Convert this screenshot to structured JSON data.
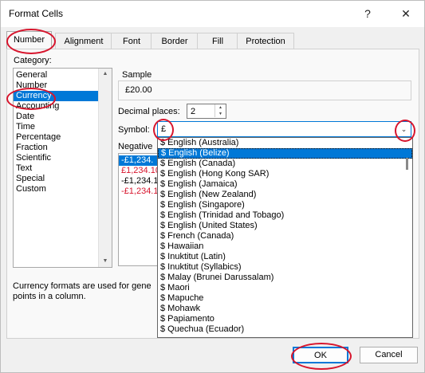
{
  "window": {
    "title": "Format Cells",
    "help_glyph": "?",
    "close_glyph": "✕"
  },
  "tabs": [
    "Number",
    "Alignment",
    "Font",
    "Border",
    "Fill",
    "Protection"
  ],
  "category": {
    "label": "Category:",
    "items": [
      "General",
      "Number",
      "Currency",
      "Accounting",
      "Date",
      "Time",
      "Percentage",
      "Fraction",
      "Scientific",
      "Text",
      "Special",
      "Custom"
    ],
    "selected": "Currency"
  },
  "sample": {
    "label": "Sample",
    "value": "£20.00"
  },
  "decimal": {
    "label": "Decimal places:",
    "value": "2"
  },
  "symbol": {
    "label": "Symbol:",
    "value": "£",
    "options": [
      "$ English (Australia)",
      "$ English (Belize)",
      "$ English (Canada)",
      "$ English (Hong Kong SAR)",
      "$ English (Jamaica)",
      "$ English (New Zealand)",
      "$ English (Singapore)",
      "$ English (Trinidad and Tobago)",
      "$ English (United States)",
      "$ French (Canada)",
      "$ Hawaiian",
      "$ Inuktitut (Latin)",
      "$ Inuktitut (Syllabics)",
      "$ Malay (Brunei Darussalam)",
      "$ Maori",
      "$ Mapuche",
      "$ Mohawk",
      "$ Papiamento",
      "$ Quechua (Ecuador)"
    ],
    "highlighted": "$ English (Belize)"
  },
  "negative": {
    "label": "Negative",
    "items": [
      {
        "text": "-£1,234.",
        "color": "#000000",
        "selected": true
      },
      {
        "text": "£1,234.10",
        "color": "#d7152d",
        "selected": false
      },
      {
        "text": "-£1,234.1",
        "color": "#000000",
        "selected": false
      },
      {
        "text": "-£1,234.1",
        "color": "#d7152d",
        "selected": false
      }
    ]
  },
  "description": {
    "line1": "Currency formats are used for gene",
    "line2": "points in a column."
  },
  "buttons": {
    "ok": "OK",
    "cancel": "Cancel"
  },
  "colors": {
    "accent": "#0078d7",
    "annotation": "#d7152d"
  }
}
